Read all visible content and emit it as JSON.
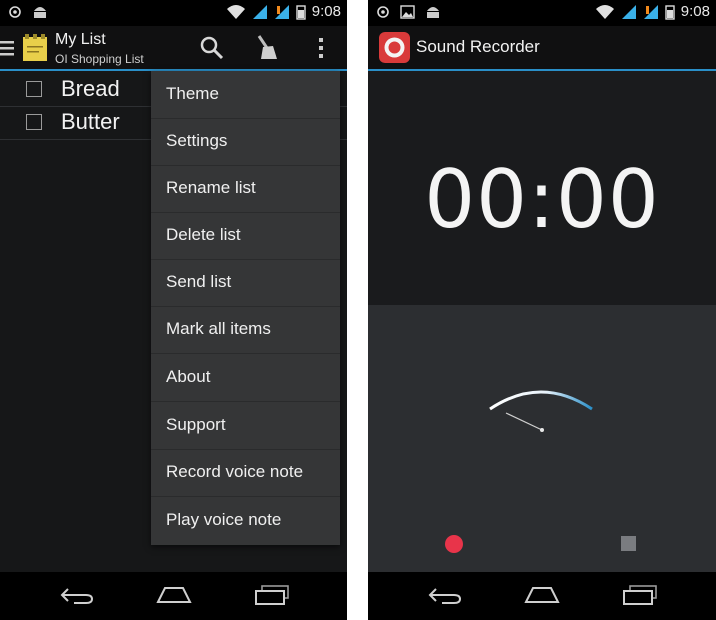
{
  "left_screen": {
    "status_bar": {
      "time": "9:08"
    },
    "action_bar": {
      "title": "My List",
      "subtitle": "OI Shopping List"
    },
    "list_items": [
      {
        "label": "Bread",
        "checked": false
      },
      {
        "label": "Butter",
        "checked": false
      }
    ],
    "menu": {
      "items": [
        "Theme",
        "Settings",
        "Rename list",
        "Delete list",
        "Send list",
        "Mark all items",
        "About",
        "Support",
        "Record voice note",
        "Play voice note"
      ]
    }
  },
  "right_screen": {
    "status_bar": {
      "time": "9:08"
    },
    "action_bar": {
      "title": "Sound Recorder"
    },
    "timer": "00:00",
    "colors": {
      "record": "#e8344a",
      "accent": "#2a8fc8"
    }
  }
}
